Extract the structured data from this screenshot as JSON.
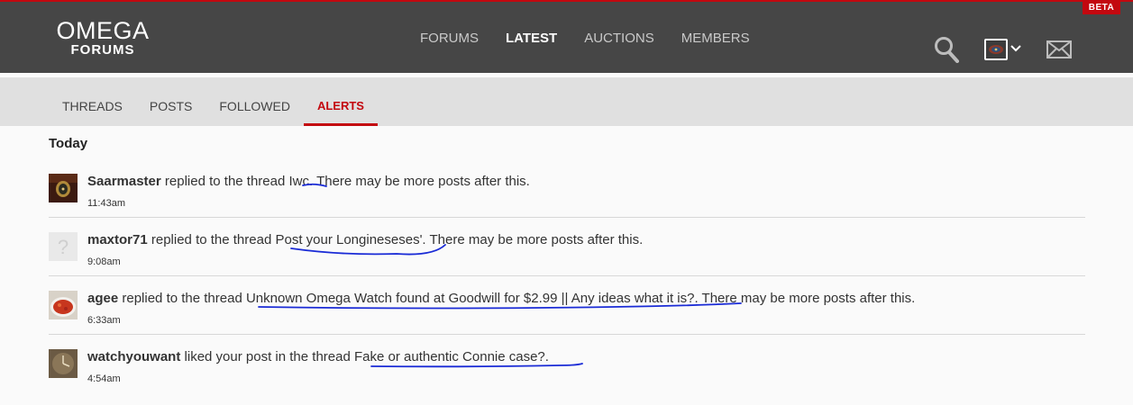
{
  "header": {
    "beta": "BETA",
    "logo_main": "OMEGA",
    "logo_sub": "FORUMS",
    "nav": [
      {
        "label": "FORUMS"
      },
      {
        "label": "LATEST"
      },
      {
        "label": "AUCTIONS"
      },
      {
        "label": "MEMBERS"
      }
    ],
    "active_nav": "LATEST",
    "icons": [
      "search-icon",
      "user-avatar",
      "chevron-down-icon",
      "mail-icon"
    ]
  },
  "subnav": {
    "items": [
      {
        "label": "THREADS"
      },
      {
        "label": "POSTS"
      },
      {
        "label": "FOLLOWED"
      },
      {
        "label": "ALERTS"
      }
    ],
    "active": "ALERTS"
  },
  "section_title": "Today",
  "alerts": [
    {
      "user": "Saarmaster",
      "action": " replied to the thread ",
      "thread": "Iwc.",
      "suffix": " There may be more posts after this.",
      "time": "11:43am"
    },
    {
      "user": "maxtor71",
      "action": " replied to the thread ",
      "thread": "Post your Longineseses'.",
      "suffix": " There may be more posts after this.",
      "time": "9:08am"
    },
    {
      "user": "agee",
      "action": " replied to the thread ",
      "thread": "Unknown Omega Watch found at Goodwill for $2.99 || Any ideas what it is?.",
      "suffix": " There may be more posts after this.",
      "time": "6:33am"
    },
    {
      "user": "watchyouwant",
      "action": " liked your post in the thread ",
      "thread": "Fake or authentic Connie case?.",
      "suffix": "",
      "time": "4:54am"
    }
  ],
  "colors": {
    "header_bg": "#464646",
    "accent_red": "#c3080f",
    "subnav_bg": "#e0e0e0",
    "annotation_ink": "#1a2bd6"
  }
}
